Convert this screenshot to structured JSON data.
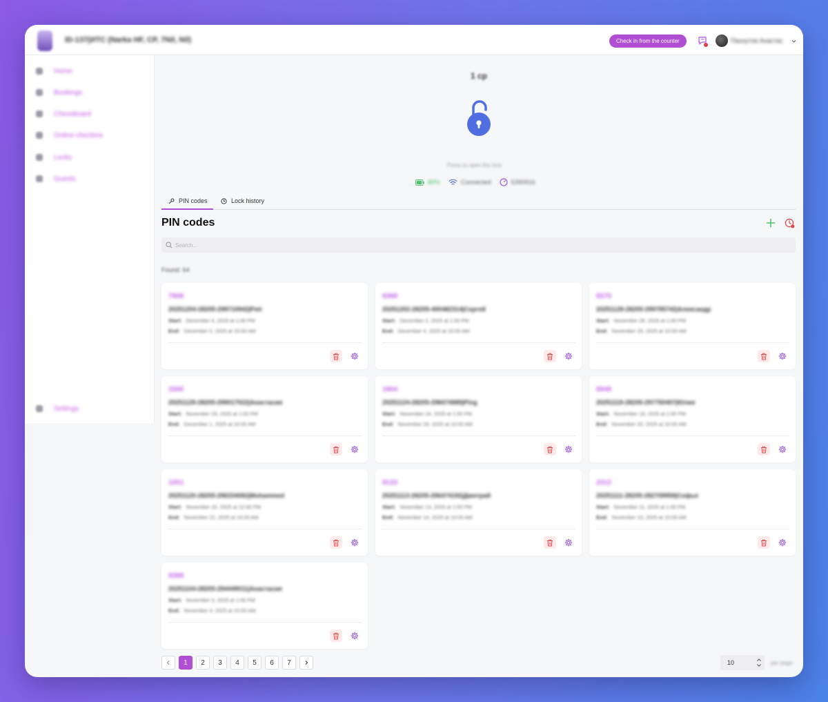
{
  "header": {
    "title": "ID-137(ИТС (Narka HF, CP, 7Nil, Nil)",
    "checkin_label": "Check in from the counter",
    "user_name": "Пахнутов Анастас"
  },
  "sidebar": {
    "items": [
      {
        "label": "Home",
        "icon": "home-icon"
      },
      {
        "label": "Bookings",
        "icon": "calendar-icon"
      },
      {
        "label": "Chessboard",
        "icon": "grid-icon"
      },
      {
        "label": "Online-checkins",
        "icon": "card-icon"
      },
      {
        "label": "Locks",
        "icon": "lock-icon"
      },
      {
        "label": "Guests",
        "icon": "user-icon"
      }
    ],
    "settings_label": "Settings"
  },
  "lock": {
    "title": "1 ср",
    "hint": "Press to open the lock",
    "battery": "80%",
    "connection": "Connected",
    "code": "5390916"
  },
  "tabs": [
    {
      "label": "PIN codes",
      "icon": "key-icon",
      "active": true
    },
    {
      "label": "Lock history",
      "icon": "history-icon",
      "active": false
    }
  ],
  "section": {
    "title": "PIN codes",
    "search_placeholder": "Search...",
    "found": "Found: 64"
  },
  "labels": {
    "start": "Start:",
    "end": "End:"
  },
  "pin_cards": [
    {
      "pin": "7908",
      "name": "20251204-28205-299710942|Petr",
      "start": "December 4, 2025 at 1:00 PM",
      "end": "December 5, 2025 at 10:00 AM"
    },
    {
      "pin": "9368",
      "name": "20251202-28205-400482314|Сергей",
      "start": "December 2, 2025 at 1:00 PM",
      "end": "December 4, 2025 at 10:00 AM"
    },
    {
      "pin": "6570",
      "name": "20251128-28205-299795742|Александр",
      "start": "November 28, 2025 at 1:00 PM",
      "end": "November 29, 2025 at 10:00 AM"
    },
    {
      "pin": "3300",
      "name": "20251129-28205-299017022|Анастасия",
      "start": "November 29, 2025 at 1:00 PM",
      "end": "December 1, 2025 at 10:00 AM"
    },
    {
      "pin": "1904",
      "name": "20251124-28205-298474985|Ping",
      "start": "November 24, 2025 at 1:00 PM",
      "end": "November 26, 2025 at 10:00 AM"
    },
    {
      "pin": "6948",
      "name": "20251119-28205-297750407|Юлия",
      "start": "November 19, 2025 at 1:00 PM",
      "end": "November 20, 2025 at 10:00 AM"
    },
    {
      "pin": "1051",
      "name": "20251120-28205-296334082|Mohammed",
      "start": "November 20, 2025 at 12:00 PM",
      "end": "November 22, 2025 at 10:00 AM"
    },
    {
      "pin": "9133",
      "name": "20251113-28205-296474192|Дмитрий",
      "start": "November 13, 2025 at 1:00 PM",
      "end": "November 14, 2025 at 10:00 AM"
    },
    {
      "pin": "2312",
      "name": "20251111-28205-282709959|Софья",
      "start": "November 11, 2025 at 1:00 PM",
      "end": "November 13, 2025 at 10:00 AM"
    },
    {
      "pin": "9388",
      "name": "20251104-28205-294449011|Анастасия",
      "start": "November 3, 2025 at 1:00 PM",
      "end": "November 4, 2025 at 10:00 AM"
    }
  ],
  "pagination": {
    "pages": [
      "1",
      "2",
      "3",
      "4",
      "5",
      "6",
      "7"
    ],
    "current": "1",
    "prev_icon": "chevron-left-icon",
    "next_icon": "chevron-right-icon",
    "per_page_value": "10",
    "per_page_label": "per page"
  },
  "colors": {
    "accent": "#b04fd3",
    "lock_blue": "#4f6fe0",
    "delete_red": "#e04b4b",
    "battery_green": "#4cc46a"
  }
}
